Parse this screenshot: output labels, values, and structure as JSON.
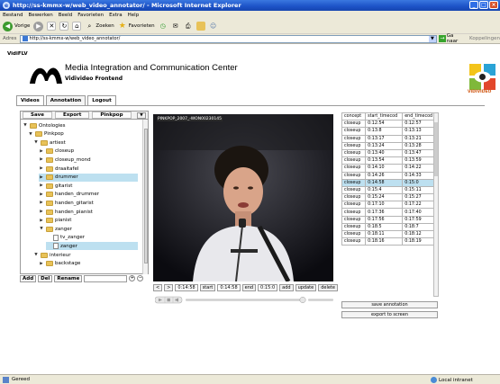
{
  "window": {
    "title": "http://ss-kmmx-w/web_video_annotator/ - Microsoft Internet Explorer"
  },
  "menubar": [
    "Bestand",
    "Bewerken",
    "Beeld",
    "Favorieten",
    "Extra",
    "Help"
  ],
  "toolbar": {
    "back_label": "Vorige",
    "search_label": "Zoeken",
    "favorites_label": "Favorieten"
  },
  "address": {
    "label": "Adres",
    "url": "http://ss-kmmx-w/web_video_annotator/",
    "go_label": "Ga naar",
    "links_label": "Koppelingen"
  },
  "app": {
    "name": "VidiFLV",
    "center_title": "Media Integration and Communication Center",
    "center_subtitle": "Vidivideo Frontend",
    "vidi_logo_text": "VIDIVIDEO"
  },
  "tabs": [
    "Videos",
    "Annotation",
    "Logout"
  ],
  "tree_panel": {
    "save_label": "Save",
    "export_label": "Export",
    "pinkpop_label": "Pinkpop",
    "items": [
      {
        "label": "Ontologies",
        "expander": "▼",
        "icon": "folder-icon",
        "selected": false
      },
      {
        "label": "Pinkpop",
        "expander": "▼",
        "icon": "folder-icon",
        "selected": false
      },
      {
        "label": "artiest",
        "expander": "▼",
        "icon": "folder-icon",
        "selected": false
      },
      {
        "label": "closeup",
        "expander": "▶",
        "icon": "folder-icon",
        "selected": false
      },
      {
        "label": "closeup_mond",
        "expander": "▶",
        "icon": "folder-icon",
        "selected": false
      },
      {
        "label": "draaitafel",
        "expander": "▶",
        "icon": "folder-icon",
        "selected": false
      },
      {
        "label": "drummer",
        "expander": "▶",
        "icon": "folder-icon",
        "selected": true
      },
      {
        "label": "gitarist",
        "expander": "▶",
        "icon": "folder-icon",
        "selected": false
      },
      {
        "label": "handen_drummer",
        "expander": "▶",
        "icon": "folder-icon",
        "selected": false
      },
      {
        "label": "handen_gitarist",
        "expander": "▶",
        "icon": "folder-icon",
        "selected": false
      },
      {
        "label": "handen_pianist",
        "expander": "▶",
        "icon": "folder-icon",
        "selected": false
      },
      {
        "label": "pianist",
        "expander": "▶",
        "icon": "folder-icon",
        "selected": false
      },
      {
        "label": "zanger",
        "expander": "▼",
        "icon": "folder-icon",
        "selected": false
      },
      {
        "label": "tv_zanger",
        "expander": "",
        "icon": "document-icon",
        "selected": false
      },
      {
        "label": "zanger",
        "expander": "",
        "icon": "document-icon",
        "selected": true
      },
      {
        "label": "interieur",
        "expander": "▼",
        "icon": "folder-icon",
        "selected": false
      },
      {
        "label": "backstage",
        "expander": "▶",
        "icon": "folder-icon",
        "selected": false
      }
    ],
    "actions": {
      "add": "Add",
      "del": "Del",
      "rename": "Rename"
    }
  },
  "video": {
    "caption": "PINKPOP_2007_-WON00230145",
    "prev_label": "<",
    "next_label": ">",
    "current_time": "0:14:58",
    "start_label": "start",
    "start_value": "0:14:58",
    "end_label": "end",
    "end_value": "0:15:0",
    "add_label": "add",
    "update_label": "update",
    "delete_label": "delete"
  },
  "annotations": {
    "headers": [
      "concept",
      "start_timecod",
      "end_timecod"
    ],
    "rows": [
      [
        "closeup",
        "0:12:54",
        "0:12:57"
      ],
      [
        "closeup",
        "0:13:8",
        "0:13:13"
      ],
      [
        "closeup",
        "0:13:17",
        "0:13:21"
      ],
      [
        "closeup",
        "0:13:24",
        "0:13:28"
      ],
      [
        "closeup",
        "0:13:40",
        "0:13:47"
      ],
      [
        "closeup",
        "0:13:54",
        "0:13:59"
      ],
      [
        "closeup",
        "0:14:10",
        "0:14:22"
      ],
      [
        "closeup",
        "0:14:26",
        "0:14:33"
      ],
      [
        "closeup",
        "0:14:58",
        "0:15:0"
      ],
      [
        "closeup",
        "0:15:4",
        "0:15:11"
      ],
      [
        "closeup",
        "0:15:24",
        "0:15:27"
      ],
      [
        "closeup",
        "0:17:10",
        "0:17:22"
      ],
      [
        "closeup",
        "0:17:36",
        "0:17:40"
      ],
      [
        "closeup",
        "0:17:56",
        "0:17:59"
      ],
      [
        "closeup",
        "0:18:5",
        "0:18:7"
      ],
      [
        "closeup",
        "0:18:11",
        "0:18:12"
      ],
      [
        "closeup",
        "0:18:16",
        "0:18:19"
      ]
    ],
    "selected_row": 8,
    "save_label": "save annotation",
    "export_label": "export to screen"
  },
  "status": {
    "text": "Gereed",
    "zone": "Local intranet"
  }
}
